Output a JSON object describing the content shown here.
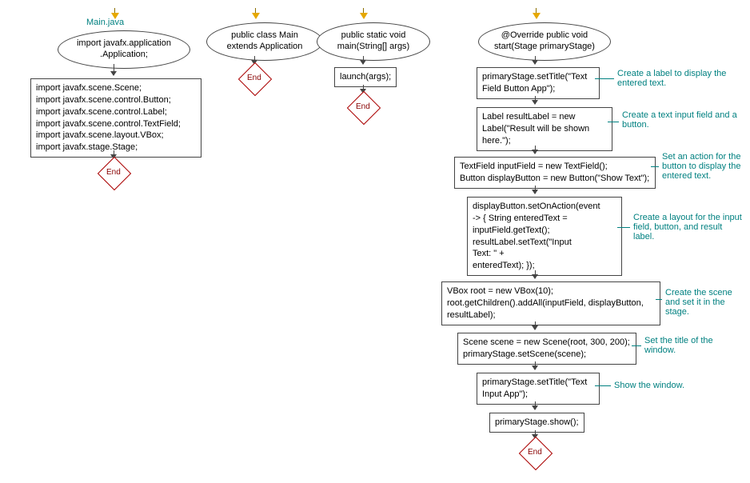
{
  "col1": {
    "title": "Main.java",
    "ellipse": "import javafx.application\n.Application;",
    "imports": "import javafx.scene.Scene;\nimport javafx.scene.control.Button;\nimport javafx.scene.control.Label;\nimport javafx.scene.control.TextField;\nimport javafx.scene.layout.VBox;\nimport javafx.stage.Stage;",
    "end": "End"
  },
  "col2": {
    "ellipse": "public class Main\nextends Application",
    "end": "End"
  },
  "col3": {
    "ellipse": "public static void\nmain(String[] args)",
    "code": "launch(args);",
    "end": "End"
  },
  "col4": {
    "ellipse": "@Override public void\nstart(Stage primaryStage)",
    "step1": "primaryStage.setTitle(\"Text\nField Button App\");",
    "annot1": "Create a label to display\nthe entered text.",
    "step2": "Label resultLabel = new\nLabel(\"Result will be shown\nhere.\");",
    "annot2": "Create a text input field\nand a button.",
    "step3": "TextField inputField = new TextField();\nButton displayButton = new Button(\"Show Text\");",
    "annot3": "Set an action for the\nbutton to display the\nentered text.",
    "step4": "displayButton.setOnAction(event\n-> { String enteredText =\ninputField.getText();\nresultLabel.setText(\"Input\nText: \" +\nenteredText); });",
    "annot4": "Create a layout for the\ninput field, button, and\nresult label.",
    "step5": "VBox root = new VBox(10);\nroot.getChildren().addAll(inputField, displayButton,\nresultLabel);",
    "annot5": "Create the scene and set\nit in the stage.",
    "step6": "Scene scene = new Scene(root, 300, 200);\nprimaryStage.setScene(scene);",
    "annot6": "Set the title\nof the window.",
    "step7": "primaryStage.setTitle(\"Text\nInput App\");",
    "annot7": "Show the window.",
    "step8": "primaryStage.show();",
    "end": "End"
  }
}
